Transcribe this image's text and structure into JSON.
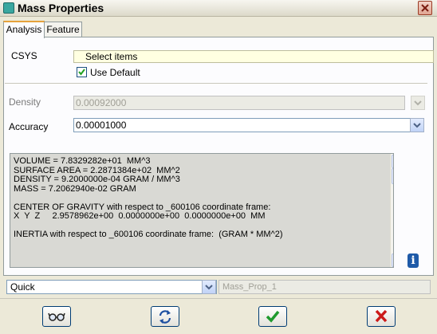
{
  "window": {
    "title": "Mass Properties",
    "icon": "dialog-icon"
  },
  "tabs": [
    {
      "label": "Analysis",
      "active": true
    },
    {
      "label": "Feature",
      "active": false
    }
  ],
  "csys": {
    "label": "CSYS",
    "select_placeholder": "Select items",
    "use_default_label": "Use Default",
    "use_default_checked": true
  },
  "density": {
    "label": "Density",
    "value": "0.00092000",
    "enabled": false
  },
  "accuracy": {
    "label": "Accuracy",
    "value": "0.00001000"
  },
  "results": [
    "VOLUME = 7.8329282e+01  MM^3",
    "SURFACE AREA = 2.2871384e+02  MM^2",
    "DENSITY = 9.2000000e-04 GRAM / MM^3",
    "MASS = 7.2062940e-02 GRAM",
    "",
    "CENTER OF GRAVITY with respect to _600106 coordinate frame:",
    "X  Y  Z     2.9578962e+00  0.0000000e+00  0.0000000e+00  MM",
    "",
    "INERTIA with respect to _600106 coordinate frame:  (GRAM * MM^2)"
  ],
  "mode": {
    "value": "Quick"
  },
  "feature_name": {
    "value": "Mass_Prop_1"
  },
  "buttons": [
    {
      "name": "preview-button",
      "icon": "glasses-icon"
    },
    {
      "name": "repaint-button",
      "icon": "refresh-icon"
    },
    {
      "name": "ok-button",
      "icon": "checkmark-icon"
    },
    {
      "name": "cancel-button",
      "icon": "close-x-icon"
    }
  ],
  "colors": {
    "checkmark": "#1f9a2e",
    "cancel": "#cc1a1a",
    "info": "#1e5aa8",
    "select_bg": "#ffffe1"
  }
}
